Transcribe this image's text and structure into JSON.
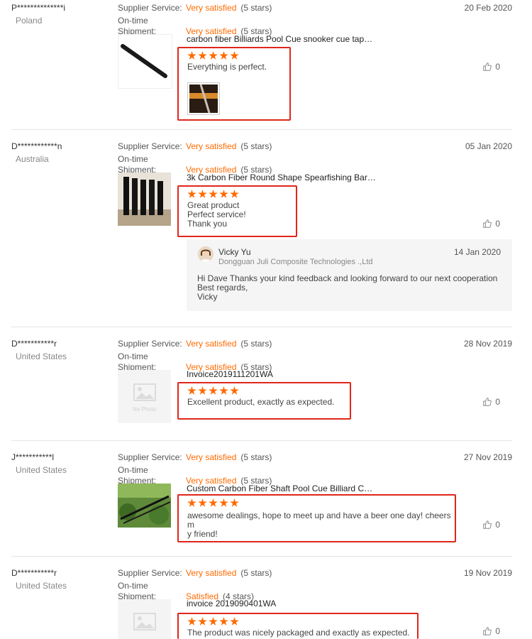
{
  "labels": {
    "supplier_service": "Supplier Service:",
    "ontime": "On-time",
    "shipment": "Shipment:"
  },
  "colors": {
    "accent": "#ff6a00",
    "highlight_box": "#e0261b"
  },
  "reviews": [
    {
      "buyer": "P**************i",
      "country": "Poland",
      "date": "20 Feb 2020",
      "supplier_rating": "Very satisfied",
      "supplier_stars": "(5 stars)",
      "shipment_rating": "Very satisfied",
      "shipment_stars": "(5 stars)",
      "product": "carbon fiber Billiards Pool Cue snooker cue tap…",
      "product_stars": 5,
      "comment": "Everything is perfect.",
      "likes": "0",
      "thumb_icon": "carbon-rod-photo-icon"
    },
    {
      "buyer": "D************n",
      "country": "Australia",
      "date": "05 Jan 2020",
      "supplier_rating": "Very satisfied",
      "supplier_stars": "(5 stars)",
      "shipment_rating": "Very satisfied",
      "shipment_stars": "(5 stars)",
      "product": "3k Carbon Fiber Round Shape Spearfishing Bar…",
      "product_stars": 5,
      "comment": "Great product\nPerfect service!\nThank you",
      "likes": "0",
      "thumb_icon": "carbon-tubes-photo-icon",
      "reply": {
        "name": "Vicky Yu",
        "company": "Dongguan Juli Composite Technologies .,Ltd",
        "date": "14 Jan 2020",
        "text": "Hi Dave Thanks your kind feedback and looking forward to our next cooperation\nBest regards,\nVicky"
      }
    },
    {
      "buyer": "D***********r",
      "country": "United States",
      "date": "28 Nov 2019",
      "supplier_rating": "Very satisfied",
      "supplier_stars": "(5 stars)",
      "shipment_rating": "Very satisfied",
      "shipment_stars": "(5 stars)",
      "product": "Invoice2019111201WA",
      "product_stars": 5,
      "comment": "Excellent product, exactly as expected.",
      "likes": "0",
      "thumb_icon": "no-photo-icon",
      "no_photo": "No Photo"
    },
    {
      "buyer": "J***********l",
      "country": "United States",
      "date": "27 Nov 2019",
      "supplier_rating": "Very satisfied",
      "supplier_stars": "(5 stars)",
      "shipment_rating": "Very satisfied",
      "shipment_stars": "(5 stars)",
      "product": "Custom Carbon Fiber Shaft Pool Cue Billiard C…",
      "product_stars": 5,
      "comment": "awesome dealings, hope to meet up and have a beer one day! cheers m\ny friend!",
      "likes": "0",
      "thumb_icon": "cue-shafts-photo-icon"
    },
    {
      "buyer": "D***********r",
      "country": "United States",
      "date": "19 Nov 2019",
      "supplier_rating": "Very satisfied",
      "supplier_stars": "(5 stars)",
      "shipment_rating": "Satisfied",
      "shipment_stars": "(4 stars)",
      "product": "invoice 2019090401WA",
      "product_stars": 5,
      "comment": "The product was nicely packaged and exactly as expected.",
      "likes": "0",
      "thumb_icon": "no-photo-icon"
    }
  ]
}
